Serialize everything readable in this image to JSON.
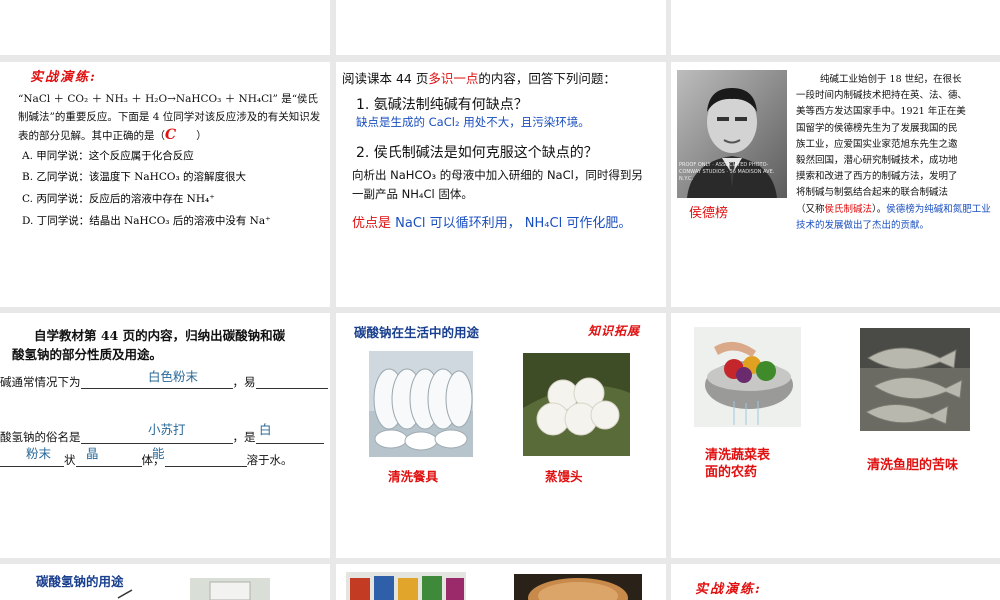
{
  "slide4": {
    "heading": "实战演练:",
    "question": "“NaCl ＋ CO₂ ＋ NH₃ ＋ H₂O→NaHCO₃ ＋ NH₄Cl” 是“侯氏制碱法”的重要反应。下面是 4 位同学对该反应涉及的有关知识发表的部分见解。其中正确的是（",
    "answer_mark": "C",
    "close_paren": "）",
    "options": [
      "A. 甲同学说：这个反应属于化合反应",
      "B. 乙同学说：该温度下 NaHCO₃ 的溶解度很大",
      "C. 丙同学说：反应后的溶液中存在 NH₄⁺",
      "D. 丁同学说：结晶出 NaHCO₃ 后的溶液中没有 Na⁺"
    ]
  },
  "slide5": {
    "intro_pre": "阅读课本 44 页",
    "intro_red": "多识一点",
    "intro_post": "的内容，回答下列问题：",
    "q1": "1. 氨碱法制纯碱有何缺点？",
    "a1": "缺点是生成的 CaCl₂ 用处不大，且污染环境。",
    "q2": "2. 侯氏制碱法是如何克服这个缺点的？",
    "a2": "向析出 NaHCO₃ 的母液中加入研细的 NaCl，同时得到另一副产品 NH₄Cl 固体。",
    "adv_red": "优点是",
    "adv_blue": " NaCl 可以循环利用， NH₄Cl 可作化肥。"
  },
  "slide6": {
    "portrait_caption": "侯德榜",
    "photo_text": "PROOF ONLY · ASSOCIATED PHOTO-CONWAY STUDIOS · 56 MADISON AVE. N.Y.C.",
    "para_lines": [
      "纯碱工业始创于 18 世纪，在很长",
      "一段时间内制碱技术把持在英、法、德、",
      "美等西方发达国家手中。1921 年正在美",
      "国留学的侯德榜先生为了发展我国的民",
      "族工业，应爱国实业家范旭东先生之邀",
      "毅然回国，潜心研究制碱技术，成功地",
      "摸索和改进了西方的制碱方法，发明了",
      "将制碱与制氨结合起来的联合制碱法"
    ],
    "tail_pre": "（又称",
    "tail_red": "侯氏制碱法",
    "tail_mid": "）。",
    "tail_blue": "侯德榜为纯碱和氮肥工业技术的发展做出了杰出的贡献。"
  },
  "slide7": {
    "title_line1": "自学教材第 44 页的内容，归纳出碳酸钠和碳",
    "title_line2": "酸氢钠的部分性质及用途。",
    "line1_pre": "碱通常情况下为",
    "fill_white_powder": "白色粉末",
    "line1_post": "，易",
    "line2_pre": "酸氢钠的俗名是",
    "fill_xiaosuda": "小苏打",
    "line2_mid": "，是",
    "fill_bai": "白",
    "fill_fenmo": "粉末",
    "line3_zhuang": "状",
    "fill_jing": "晶",
    "line3_ti": "体，",
    "fill_neng": "能",
    "line3_post": "溶于水。"
  },
  "slide8": {
    "title": "碳酸钠在生活中的用途",
    "tag": "知识拓展",
    "cap1": "清洗餐具",
    "cap2": "蒸馒头"
  },
  "slide9": {
    "cap1_line1": "清洗蔬菜表",
    "cap1_line2": "面的农药",
    "cap2": "清洗鱼胆的苦味"
  },
  "slide10": {
    "title": "碳酸氢钠的用途"
  },
  "slide12": {
    "heading": "实战演练:"
  },
  "colors": {
    "red": "#e01010",
    "blue": "#1a4fbf",
    "teal": "#2a6a9a"
  }
}
